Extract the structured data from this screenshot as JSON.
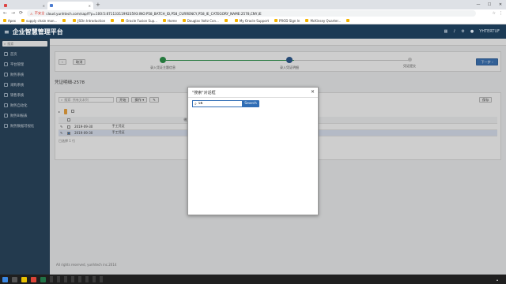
{
  "browser": {
    "tabs": [
      {
        "label": "",
        "active": false
      },
      {
        "label": "",
        "active": true
      }
    ],
    "security_label": "不安全",
    "url": "cloud.yunhtech.com/sap/f?p=100:5:871133119923593:INO:P58_BATCH_ID,P58_CURRENCY,P58_IE_CATEGORY_NAME:2578,CNY,IE",
    "bookmarks": [
      "Apex",
      "supply chain man...",
      "",
      "JSOn Introduction",
      "",
      "Oracle Fusion Sup...",
      "Home",
      "Douglas Voltz Con...",
      "",
      "My Oracle Support",
      "PROD Sign In",
      "McKinsey Quarter...",
      ""
    ]
  },
  "app": {
    "title": "企业智慧管理平台",
    "user": "YHTERTUF"
  },
  "sidebar": {
    "search_placeholder": "搜索",
    "items": [
      {
        "label": "首页"
      },
      {
        "label": "平台管理"
      },
      {
        "label": "财务系统"
      },
      {
        "label": "采购系统"
      },
      {
        "label": "销售系统"
      },
      {
        "label": "财务自动化"
      },
      {
        "label": "财务BI报表"
      },
      {
        "label": "财务数据可视化"
      }
    ]
  },
  "main": {
    "breadcrumbs": [
      "",
      "",
      "",
      ""
    ],
    "cancel_label": "取消",
    "next_label": "下一步 ›",
    "steps": [
      {
        "label": "录入凭证主题信息",
        "state": "done"
      },
      {
        "label": "录入凭证明细",
        "state": "current"
      },
      {
        "label": "凭证提交",
        "state": "todo"
      }
    ],
    "batch_title": "凭证明细-2578",
    "toolbar": {
      "search_placeholder": "搜索: 所有文本列",
      "go_label": "开始",
      "actions_label": "操作 ▾",
      "save_label": "保存"
    },
    "filter": {
      "chip": "",
      "text": ""
    },
    "grid": {
      "columns": [
        "",
        "",
        "借方金额",
        "",
        "",
        "",
        "",
        "",
        "",
        "",
        "",
        "",
        "",
        ""
      ],
      "rows": [
        {
          "date": "2019-09-30",
          "type": "手工凭证",
          "desc": "",
          "selected": false
        },
        {
          "date": "2019-09-30",
          "type": "手工凭证",
          "desc": "",
          "selected": true
        }
      ]
    },
    "row_count": "已选择 1 行",
    "pager": "",
    "footer": {
      "copyright": "All rights reserved, yunhtech inc.2014",
      "links": [
        "",
        "",
        "",
        ""
      ]
    }
  },
  "modal": {
    "title": "\"搜索\"对话框",
    "input_value": "56",
    "search_button": "Search"
  },
  "taskbar": {
    "items": [
      "",
      "",
      "",
      "",
      "",
      "",
      "",
      ""
    ],
    "time": "",
    "date": ""
  }
}
